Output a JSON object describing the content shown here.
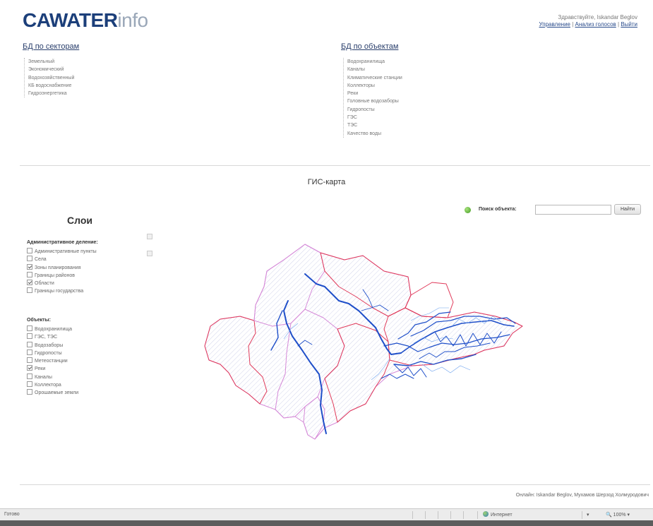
{
  "logo": {
    "brand": "CAWATER",
    "suffix": "info"
  },
  "user": {
    "greeting": "Здравствуйте, Iskandar Beglov",
    "manage": "Управление",
    "password": "Анализ голосов",
    "logout": "Выйти"
  },
  "sectors": {
    "title": "БД по секторам",
    "items": [
      "Земельный",
      "Экономический",
      "Водохозяйственный",
      "КБ водоснабжение",
      "Гидроэнергетика"
    ]
  },
  "objects": {
    "title": "БД по объектам",
    "items": [
      "Водохранилища",
      "Каналы",
      "Климатические станции",
      "Коллекторы",
      "Реки",
      "Головные водозаборы",
      "Гидропосты",
      "ГЭС",
      "ТЭС",
      "Качество воды"
    ]
  },
  "map_title": "ГИС-карта",
  "layers": {
    "title": "Слои",
    "admin": {
      "title": "Административное деление:",
      "items": [
        {
          "label": "Административные пункты",
          "checked": false
        },
        {
          "label": "Села",
          "checked": false
        },
        {
          "label": "Зоны планирования",
          "checked": true
        },
        {
          "label": "Границы районов",
          "checked": false
        },
        {
          "label": "Области",
          "checked": true
        },
        {
          "label": "Границы государства",
          "checked": false
        }
      ]
    },
    "objects": {
      "title": "Объекты:",
      "items": [
        {
          "label": "Водохранилища",
          "checked": false
        },
        {
          "label": "ГЭС, ТЭС",
          "checked": false
        },
        {
          "label": "Водозаборы",
          "checked": false
        },
        {
          "label": "Гидропосты",
          "checked": false
        },
        {
          "label": "Метеостанции",
          "checked": false
        },
        {
          "label": "Реки",
          "checked": true
        },
        {
          "label": "Каналы",
          "checked": false
        },
        {
          "label": "Коллектора",
          "checked": false
        },
        {
          "label": "Орошаемые земли",
          "checked": false
        }
      ]
    }
  },
  "search": {
    "label": "Поиск объекта:",
    "value": "",
    "button": "Найти"
  },
  "online": "Онлайн: Iskandar Beglov, Мухамов Шерзод Холмуродович",
  "statusbar": {
    "status": "Готово",
    "zone": "Интернет",
    "zoom": "100%"
  },
  "colors": {
    "brand": "#1c3f7a",
    "rivers": "#1f4fc9",
    "borders": "#e03a5a",
    "zones": "#c28ad6"
  }
}
